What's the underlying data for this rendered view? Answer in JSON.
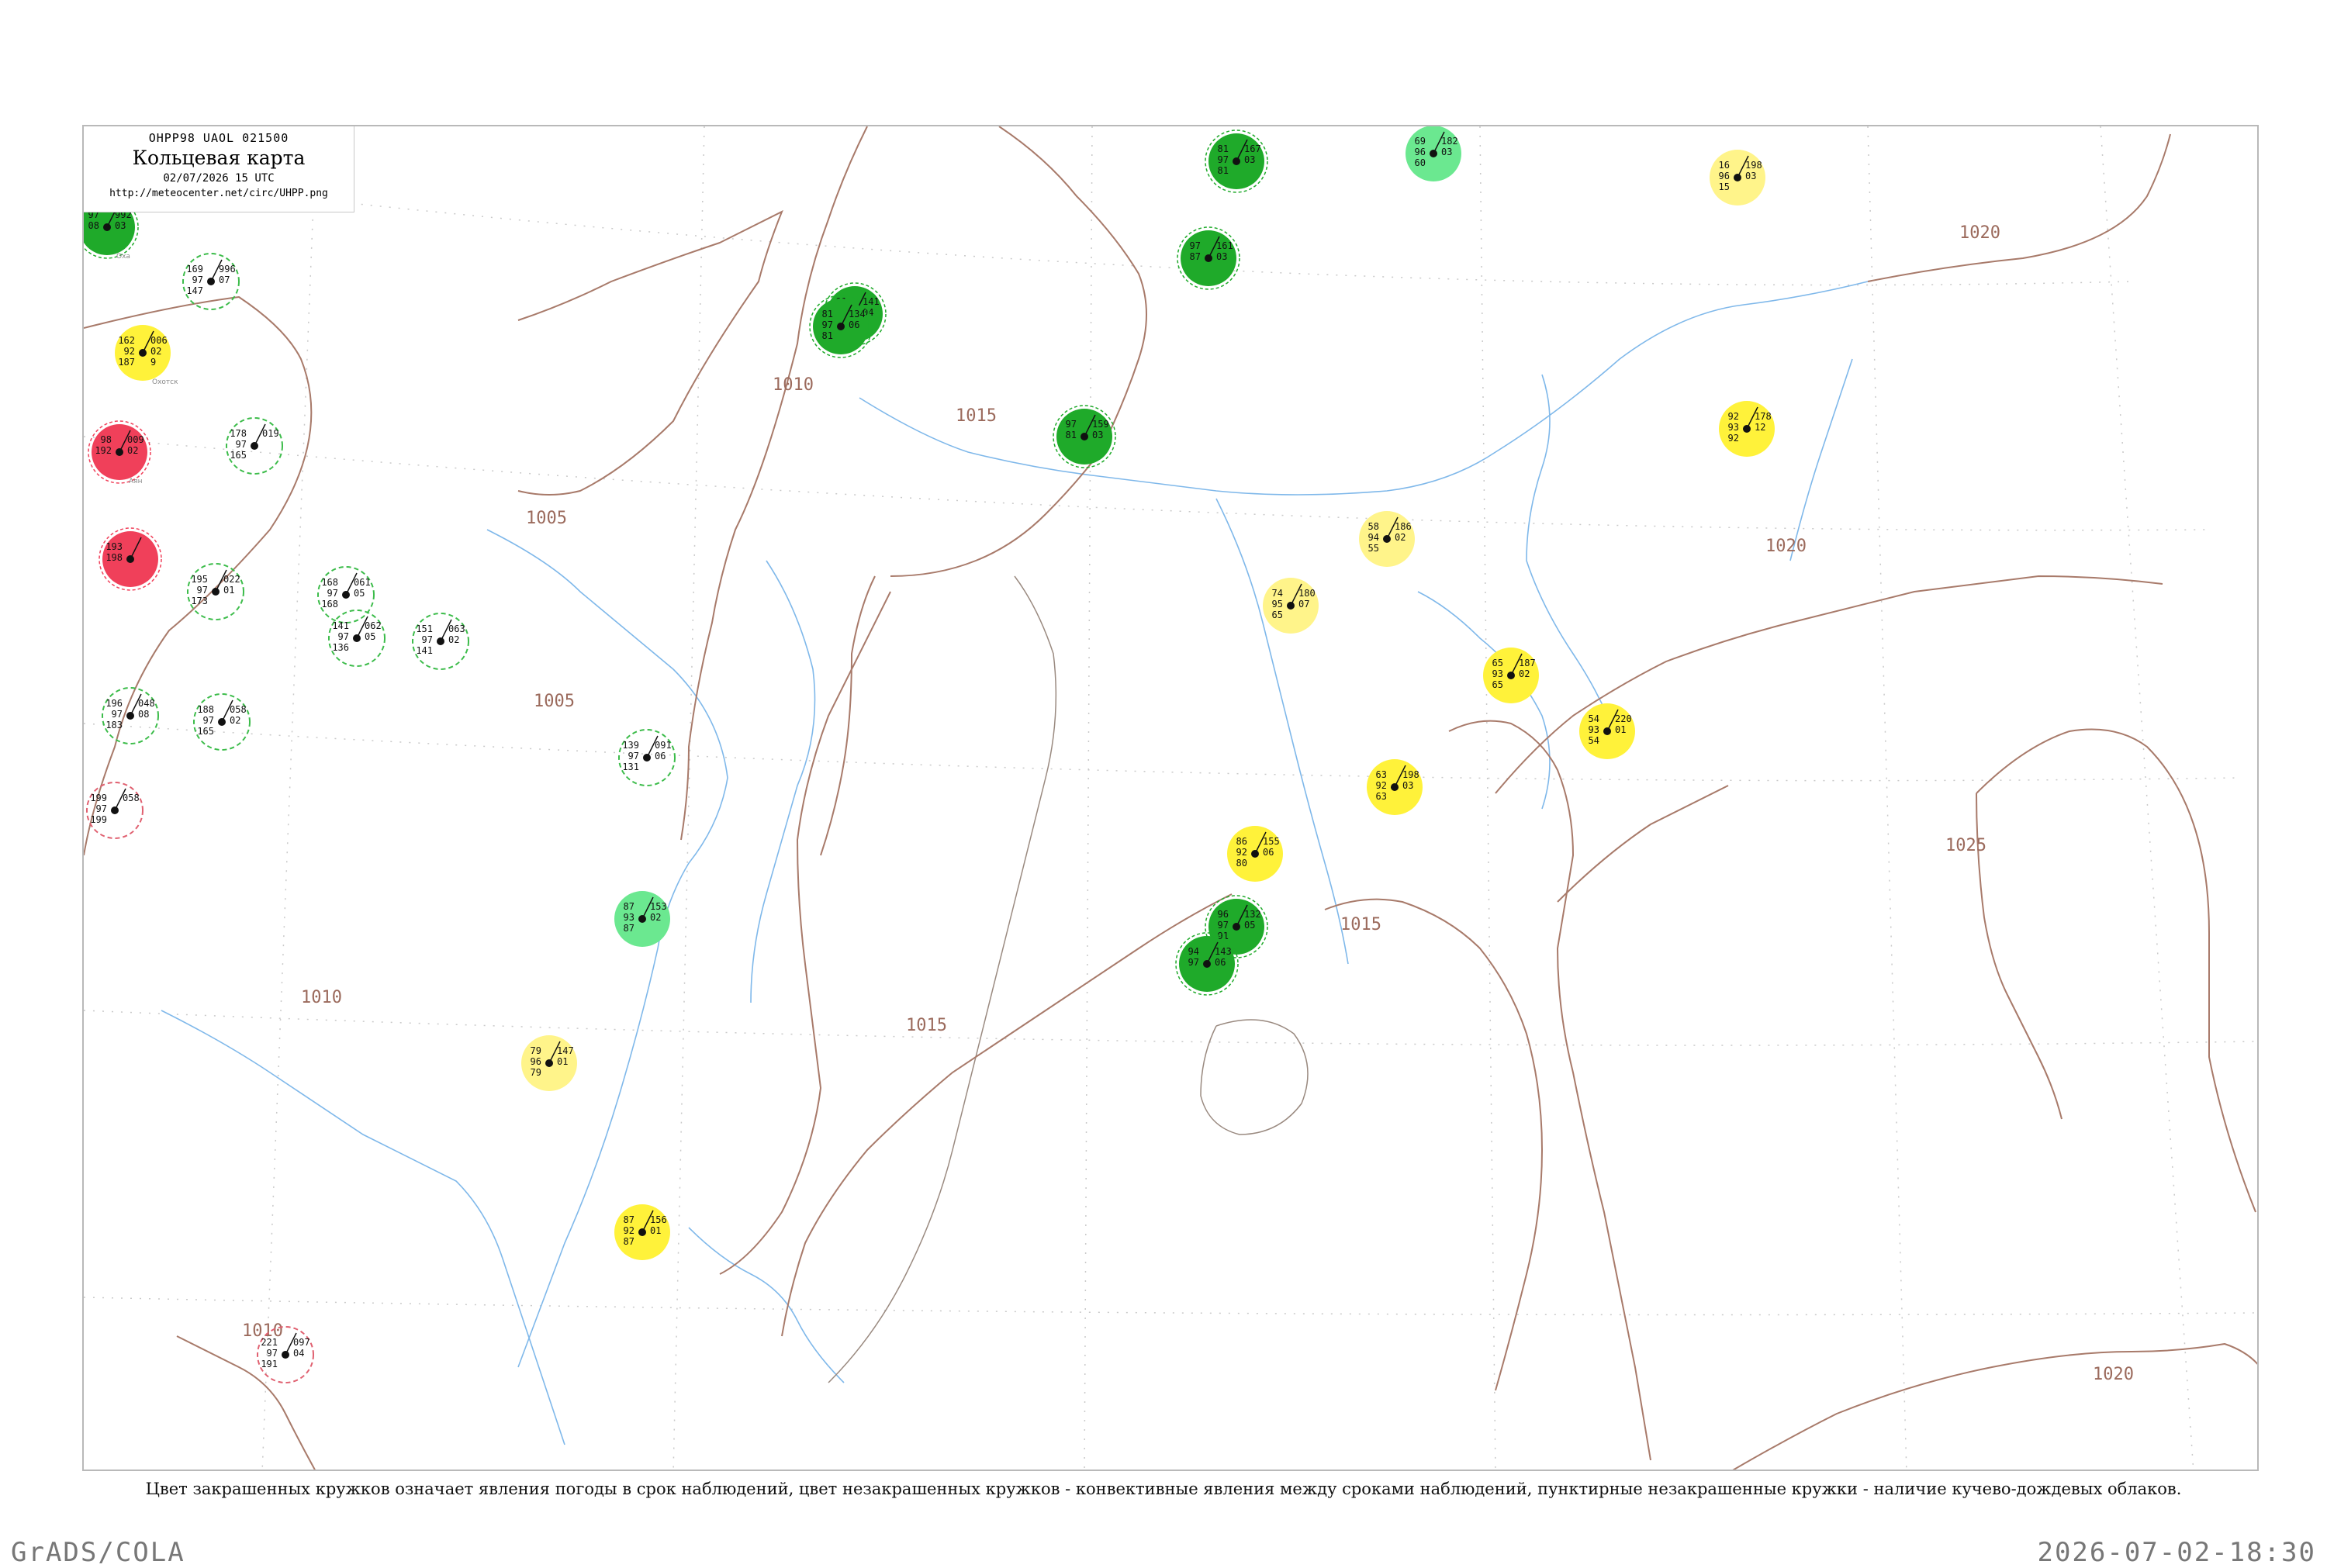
{
  "header": {
    "code_line": "ОНРР98 UAOL 021500",
    "title": "Кольцевая карта",
    "date": "02/07/2026 15 UTC",
    "url": "http://meteocenter.net/circ/UHPP.png"
  },
  "footer": {
    "note": "Цвет закрашенных кружков означает явления погоды в срок наблюдений, цвет незакрашенных кружков - конвективные явления между сроками наблюдений, пунктирные незакрашенные кружки - наличие кучево-дождевых облаков.",
    "software": "GrADS/COLA",
    "timestamp": "2026-07-02-18:30"
  },
  "colors": {
    "isobar": "#a87a6a",
    "river": "#7fb8ea",
    "green_dark": "#1faa2a",
    "green_light": "#6be890",
    "yellow": "#fff23a",
    "yellow_light": "#fff48a",
    "red": "#f0405a",
    "dashed_green": "#3cbc4a",
    "dashed_red": "#e06070"
  },
  "isobars": [
    {
      "label": "1005"
    },
    {
      "label": "1005"
    },
    {
      "label": "1010"
    },
    {
      "label": "1010"
    },
    {
      "label": "1010"
    },
    {
      "label": "1015"
    },
    {
      "label": "1015"
    },
    {
      "label": "1015"
    },
    {
      "label": "1020"
    },
    {
      "label": "1020"
    },
    {
      "label": "1020"
    },
    {
      "label": "1025"
    }
  ],
  "stations": [
    {
      "id": "s1",
      "type": "green_dark",
      "lines": [
        "97",
        "08"
      ],
      "right": [
        "992",
        "03"
      ],
      "name": "Оха"
    },
    {
      "id": "s2",
      "type": "dashed_green",
      "lines": [
        "169",
        "97",
        "147"
      ],
      "right": [
        "996",
        "07"
      ],
      "name": ""
    },
    {
      "id": "s3",
      "type": "yellow",
      "lines": [
        "162",
        "92",
        "187"
      ],
      "right": [
        "006",
        "02",
        "9"
      ],
      "name": "Охотск"
    },
    {
      "id": "s4",
      "type": "red",
      "lines": [
        "98",
        "192"
      ],
      "right": [
        "009",
        "02"
      ],
      "name": "Аян"
    },
    {
      "id": "s5",
      "type": "dashed_green",
      "lines": [
        "178",
        "97",
        "165"
      ],
      "right": [
        "019",
        ""
      ],
      "name": ""
    },
    {
      "id": "s6",
      "type": "red",
      "lines": [
        "193",
        "198"
      ],
      "right": [
        "",
        ""
      ],
      "name": ""
    },
    {
      "id": "s7",
      "type": "dashed_green",
      "lines": [
        "195",
        "97",
        "173"
      ],
      "right": [
        "022",
        "01"
      ],
      "name": ""
    },
    {
      "id": "s8",
      "type": "dashed_green",
      "lines": [
        "168",
        "97",
        "168"
      ],
      "right": [
        "061",
        "05"
      ],
      "name": ""
    },
    {
      "id": "s9",
      "type": "dashed_green",
      "lines": [
        "141",
        "97",
        "136"
      ],
      "right": [
        "062",
        "05"
      ],
      "name": ""
    },
    {
      "id": "s10",
      "type": "dashed_green",
      "lines": [
        "151",
        "97",
        "141"
      ],
      "right": [
        "063",
        "02"
      ],
      "name": ""
    },
    {
      "id": "s11",
      "type": "dashed_green",
      "lines": [
        "196",
        "97",
        "183"
      ],
      "right": [
        "048",
        "08"
      ],
      "name": ""
    },
    {
      "id": "s12",
      "type": "dashed_green",
      "lines": [
        "188",
        "97",
        "165"
      ],
      "right": [
        "058",
        "02"
      ],
      "name": ""
    },
    {
      "id": "s13",
      "type": "dashed_red",
      "lines": [
        "199",
        "97",
        "199"
      ],
      "right": [
        "058",
        ""
      ],
      "name": ""
    },
    {
      "id": "s14",
      "type": "dashed_green",
      "lines": [
        "139",
        "97",
        "131"
      ],
      "right": [
        "091",
        "06"
      ],
      "name": ""
    },
    {
      "id": "s15",
      "type": "green_light",
      "lines": [
        "87",
        "93",
        "87"
      ],
      "right": [
        "153",
        "02"
      ],
      "name": ""
    },
    {
      "id": "s16",
      "type": "yellow_light",
      "lines": [
        "79",
        "96",
        "79"
      ],
      "right": [
        "147",
        "01"
      ],
      "name": ""
    },
    {
      "id": "s17",
      "type": "yellow",
      "lines": [
        "87",
        "92",
        "87"
      ],
      "right": [
        "156",
        "01"
      ],
      "name": ""
    },
    {
      "id": "s18",
      "type": "dashed_red",
      "lines": [
        "221",
        "97",
        "191"
      ],
      "right": [
        "097",
        "04"
      ],
      "name": ""
    },
    {
      "id": "s19",
      "type": "green_dark",
      "lines": [
        "91",
        "97",
        "91"
      ],
      "right": [
        "141",
        "04"
      ],
      "name": ""
    },
    {
      "id": "s20",
      "type": "green_dark",
      "lines": [
        "81",
        "97",
        "81"
      ],
      "right": [
        "134",
        "06"
      ],
      "name": ""
    },
    {
      "id": "s21",
      "type": "green_dark",
      "lines": [
        "97",
        "87"
      ],
      "right": [
        "161",
        "03"
      ],
      "name": ""
    },
    {
      "id": "s22",
      "type": "green_dark",
      "lines": [
        "81",
        "97",
        "81"
      ],
      "right": [
        "167",
        "03"
      ],
      "name": ""
    },
    {
      "id": "s23",
      "type": "green_dark",
      "lines": [
        "97",
        "81"
      ],
      "right": [
        "159",
        "03"
      ],
      "name": ""
    },
    {
      "id": "s24",
      "type": "green_light",
      "lines": [
        "69",
        "96",
        "60"
      ],
      "right": [
        "182",
        "03"
      ],
      "name": ""
    },
    {
      "id": "s25",
      "type": "yellow_light",
      "lines": [
        "16",
        "96",
        "15"
      ],
      "right": [
        "198",
        "03"
      ],
      "name": ""
    },
    {
      "id": "s26",
      "type": "yellow",
      "lines": [
        "92",
        "93",
        "92"
      ],
      "right": [
        "178",
        "12"
      ],
      "name": ""
    },
    {
      "id": "s27",
      "type": "yellow_light",
      "lines": [
        "58",
        "94",
        "55"
      ],
      "right": [
        "186",
        "02"
      ],
      "name": ""
    },
    {
      "id": "s28",
      "type": "yellow_light",
      "lines": [
        "74",
        "95",
        "65"
      ],
      "right": [
        "180",
        "07"
      ],
      "name": ""
    },
    {
      "id": "s29",
      "type": "yellow",
      "lines": [
        "65",
        "93",
        "65"
      ],
      "right": [
        "187",
        "02"
      ],
      "name": ""
    },
    {
      "id": "s30",
      "type": "yellow",
      "lines": [
        "54",
        "93",
        "54"
      ],
      "right": [
        "220",
        "01"
      ],
      "name": ""
    },
    {
      "id": "s31",
      "type": "yellow",
      "lines": [
        "63",
        "92",
        "63"
      ],
      "right": [
        "198",
        "03"
      ],
      "name": ""
    },
    {
      "id": "s32",
      "type": "yellow",
      "lines": [
        "86",
        "92",
        "80"
      ],
      "right": [
        "155",
        "06"
      ],
      "name": ""
    },
    {
      "id": "s33",
      "type": "green_dark",
      "lines": [
        "96",
        "97",
        "91"
      ],
      "right": [
        "132",
        "05"
      ],
      "name": ""
    },
    {
      "id": "s34",
      "type": "green_dark",
      "lines": [
        "94",
        "97"
      ],
      "right": [
        "143",
        "06"
      ],
      "name": ""
    }
  ]
}
